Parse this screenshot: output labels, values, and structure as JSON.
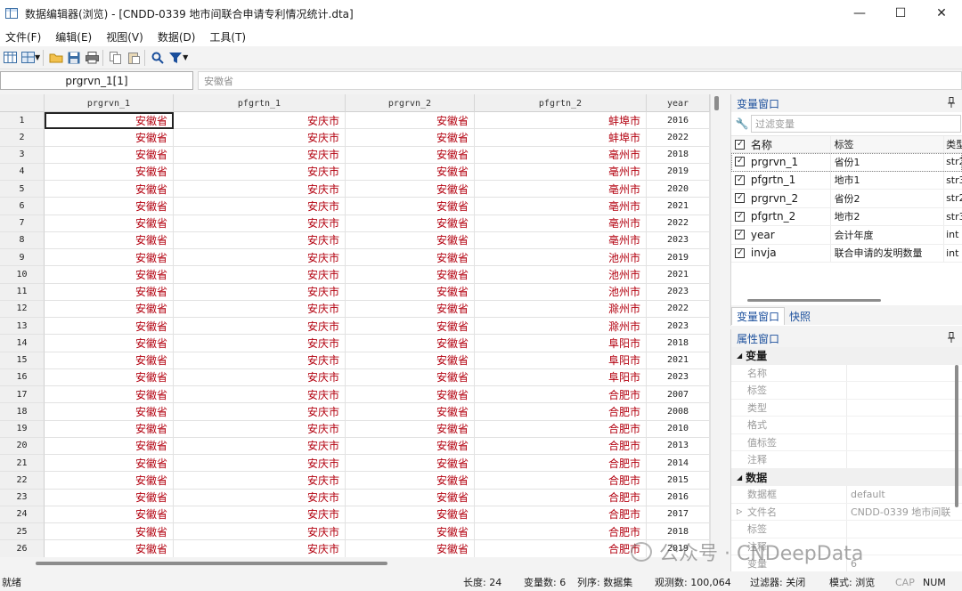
{
  "window": {
    "title": "数据编辑器(浏览) - [CNDD-0339 地市间联合申请专利情况统计.dta]",
    "minimize": "—",
    "maximize": "☐",
    "close": "✕"
  },
  "menu": [
    "文件(F)",
    "编辑(E)",
    "视图(V)",
    "数据(D)",
    "工具(T)"
  ],
  "toolbar": {
    "icons": [
      "table-icon",
      "table-view-icon",
      "open-folder-icon",
      "save-icon",
      "print-icon",
      "copy-icon",
      "paste-icon",
      "search-icon",
      "filter-icon"
    ]
  },
  "cellbar": {
    "ref": "prgrvn_1[1]",
    "value": "安徽省"
  },
  "grid": {
    "columns": [
      "prgrvn_1",
      "pfgrtn_1",
      "prgrvn_2",
      "pfgrtn_2",
      "year"
    ],
    "rows": [
      {
        "n": "1",
        "c1": "安徽省",
        "c2": "安庆市",
        "c3": "安徽省",
        "c4": "蚌埠市",
        "year": "2016"
      },
      {
        "n": "2",
        "c1": "安徽省",
        "c2": "安庆市",
        "c3": "安徽省",
        "c4": "蚌埠市",
        "year": "2022"
      },
      {
        "n": "3",
        "c1": "安徽省",
        "c2": "安庆市",
        "c3": "安徽省",
        "c4": "亳州市",
        "year": "2018"
      },
      {
        "n": "4",
        "c1": "安徽省",
        "c2": "安庆市",
        "c3": "安徽省",
        "c4": "亳州市",
        "year": "2019"
      },
      {
        "n": "5",
        "c1": "安徽省",
        "c2": "安庆市",
        "c3": "安徽省",
        "c4": "亳州市",
        "year": "2020"
      },
      {
        "n": "6",
        "c1": "安徽省",
        "c2": "安庆市",
        "c3": "安徽省",
        "c4": "亳州市",
        "year": "2021"
      },
      {
        "n": "7",
        "c1": "安徽省",
        "c2": "安庆市",
        "c3": "安徽省",
        "c4": "亳州市",
        "year": "2022"
      },
      {
        "n": "8",
        "c1": "安徽省",
        "c2": "安庆市",
        "c3": "安徽省",
        "c4": "亳州市",
        "year": "2023"
      },
      {
        "n": "9",
        "c1": "安徽省",
        "c2": "安庆市",
        "c3": "安徽省",
        "c4": "池州市",
        "year": "2019"
      },
      {
        "n": "10",
        "c1": "安徽省",
        "c2": "安庆市",
        "c3": "安徽省",
        "c4": "池州市",
        "year": "2021"
      },
      {
        "n": "11",
        "c1": "安徽省",
        "c2": "安庆市",
        "c3": "安徽省",
        "c4": "池州市",
        "year": "2023"
      },
      {
        "n": "12",
        "c1": "安徽省",
        "c2": "安庆市",
        "c3": "安徽省",
        "c4": "滁州市",
        "year": "2022"
      },
      {
        "n": "13",
        "c1": "安徽省",
        "c2": "安庆市",
        "c3": "安徽省",
        "c4": "滁州市",
        "year": "2023"
      },
      {
        "n": "14",
        "c1": "安徽省",
        "c2": "安庆市",
        "c3": "安徽省",
        "c4": "阜阳市",
        "year": "2018"
      },
      {
        "n": "15",
        "c1": "安徽省",
        "c2": "安庆市",
        "c3": "安徽省",
        "c4": "阜阳市",
        "year": "2021"
      },
      {
        "n": "16",
        "c1": "安徽省",
        "c2": "安庆市",
        "c3": "安徽省",
        "c4": "阜阳市",
        "year": "2023"
      },
      {
        "n": "17",
        "c1": "安徽省",
        "c2": "安庆市",
        "c3": "安徽省",
        "c4": "合肥市",
        "year": "2007"
      },
      {
        "n": "18",
        "c1": "安徽省",
        "c2": "安庆市",
        "c3": "安徽省",
        "c4": "合肥市",
        "year": "2008"
      },
      {
        "n": "19",
        "c1": "安徽省",
        "c2": "安庆市",
        "c3": "安徽省",
        "c4": "合肥市",
        "year": "2010"
      },
      {
        "n": "20",
        "c1": "安徽省",
        "c2": "安庆市",
        "c3": "安徽省",
        "c4": "合肥市",
        "year": "2013"
      },
      {
        "n": "21",
        "c1": "安徽省",
        "c2": "安庆市",
        "c3": "安徽省",
        "c4": "合肥市",
        "year": "2014"
      },
      {
        "n": "22",
        "c1": "安徽省",
        "c2": "安庆市",
        "c3": "安徽省",
        "c4": "合肥市",
        "year": "2015"
      },
      {
        "n": "23",
        "c1": "安徽省",
        "c2": "安庆市",
        "c3": "安徽省",
        "c4": "合肥市",
        "year": "2016"
      },
      {
        "n": "24",
        "c1": "安徽省",
        "c2": "安庆市",
        "c3": "安徽省",
        "c4": "合肥市",
        "year": "2017"
      },
      {
        "n": "25",
        "c1": "安徽省",
        "c2": "安庆市",
        "c3": "安徽省",
        "c4": "合肥市",
        "year": "2018"
      },
      {
        "n": "26",
        "c1": "安徽省",
        "c2": "安庆市",
        "c3": "安徽省",
        "c4": "合肥市",
        "year": "2019"
      }
    ]
  },
  "variables_panel": {
    "title": "变量窗口",
    "pin": "ᵖ",
    "filter_placeholder": "过滤变量",
    "headers": {
      "name": "名称",
      "label": "标签",
      "type": "类型"
    },
    "vars": [
      {
        "name": "prgrvn_1",
        "label": "省份1",
        "type": "str2"
      },
      {
        "name": "pfgrtn_1",
        "label": "地市1",
        "type": "str3"
      },
      {
        "name": "prgrvn_2",
        "label": "省份2",
        "type": "str2"
      },
      {
        "name": "pfgrtn_2",
        "label": "地市2",
        "type": "str3"
      },
      {
        "name": "year",
        "label": "会计年度",
        "type": "int"
      },
      {
        "name": "invja",
        "label": "联合申请的发明数量",
        "type": "int"
      }
    ]
  },
  "tabs": [
    "变量窗口",
    "快照"
  ],
  "properties_panel": {
    "title": "属性窗口",
    "pin": "ᵖ",
    "sections": [
      {
        "title": "变量",
        "rows": [
          {
            "key": "名称",
            "value": ""
          },
          {
            "key": "标签",
            "value": ""
          },
          {
            "key": "类型",
            "value": ""
          },
          {
            "key": "格式",
            "value": ""
          },
          {
            "key": "值标签",
            "value": ""
          },
          {
            "key": "注释",
            "value": ""
          }
        ]
      },
      {
        "title": "数据",
        "rows": [
          {
            "key": "数据框",
            "value": "default"
          },
          {
            "key": "文件名",
            "value": "CNDD-0339 地市间联"
          },
          {
            "key": "标签",
            "value": ""
          },
          {
            "key": "注释",
            "value": ""
          },
          {
            "key": "变量",
            "value": "6"
          }
        ]
      }
    ]
  },
  "status": {
    "ready": "就绪",
    "length": "长度: 24",
    "var_count": "变量数: 6",
    "order": "列序: 数据集",
    "obs": "观测数: 100,064",
    "filter": "过滤器: 关闭",
    "mode": "模式: 浏览",
    "cap": "CAP",
    "num": "NUM"
  },
  "watermark": "公众号 · CNDeepData"
}
